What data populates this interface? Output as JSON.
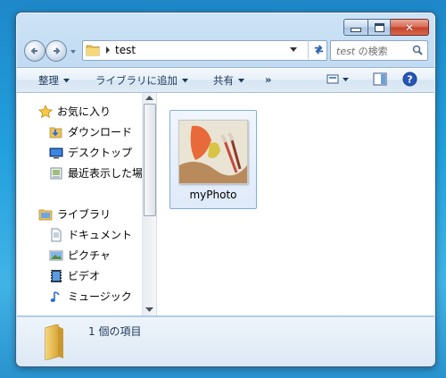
{
  "window": {
    "buttons": {
      "minimize": "minimize",
      "maximize": "maximize",
      "close": "close"
    }
  },
  "address": {
    "path": "test"
  },
  "search": {
    "placeholder_term": "test",
    "placeholder_suffix": " の検索"
  },
  "toolbar": {
    "organize": "整理",
    "include_library": "ライブラリに追加",
    "share": "共有",
    "more": "»"
  },
  "navigation": {
    "favorites": {
      "label": "お気に入り",
      "items": [
        {
          "label": "ダウンロード"
        },
        {
          "label": "デスクトップ"
        },
        {
          "label": "最近表示した場所"
        }
      ]
    },
    "libraries": {
      "label": "ライブラリ",
      "items": [
        {
          "label": "ドキュメント"
        },
        {
          "label": "ピクチャ"
        },
        {
          "label": "ビデオ"
        },
        {
          "label": "ミュージック"
        }
      ]
    }
  },
  "files": [
    {
      "name": "myPhoto"
    }
  ],
  "details": {
    "item_count": "1 個の項目"
  },
  "colors": {
    "desktop": "#23a0de",
    "window_frame": "#b6d3ef",
    "text_link": "#1e395b",
    "selection_border": "#84acdd"
  }
}
